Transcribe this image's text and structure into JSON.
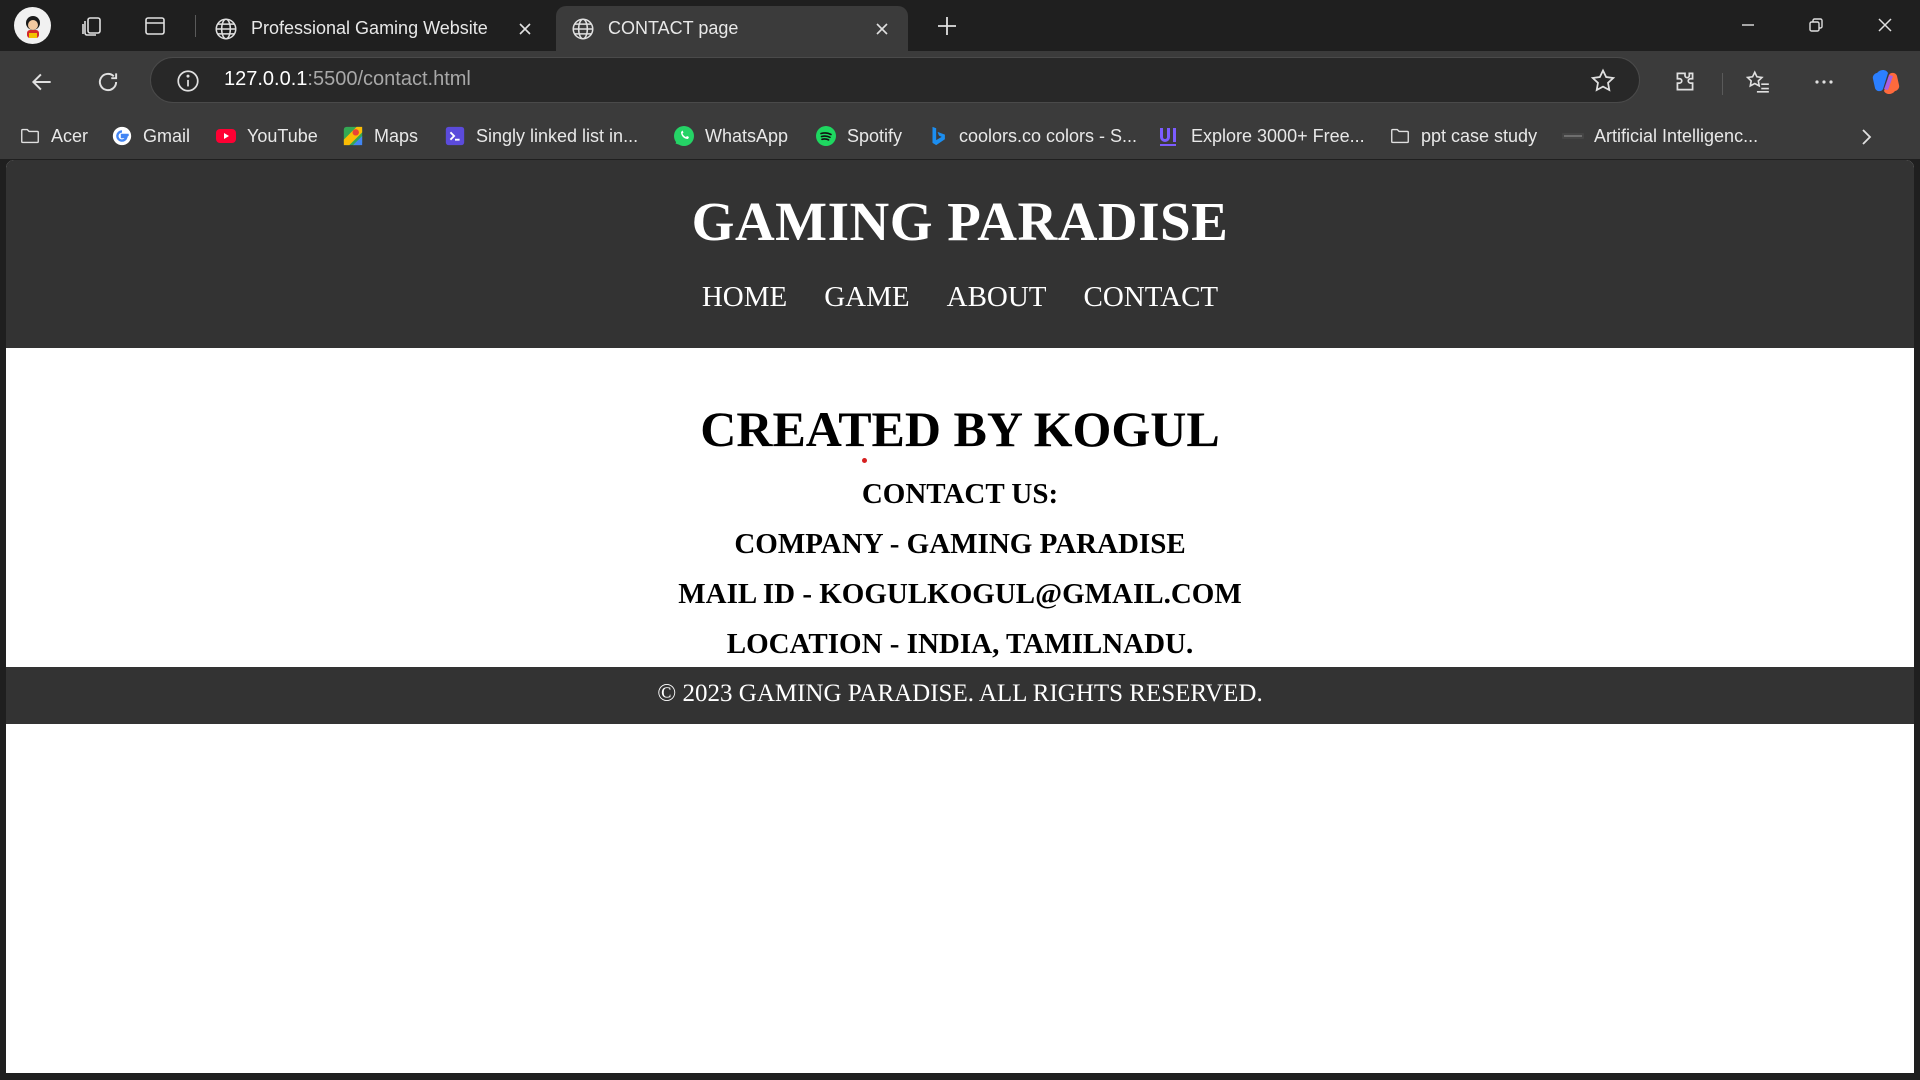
{
  "browser": {
    "tabs": [
      {
        "title": "Professional Gaming Website",
        "active": false
      },
      {
        "title": "CONTACT page",
        "active": true
      }
    ],
    "address": {
      "host": "127.0.0.1",
      "path": ":5500/contact.html"
    },
    "bookmarks": [
      {
        "label": "Acer",
        "icon": "folder-icon"
      },
      {
        "label": "Gmail",
        "icon": "google-icon"
      },
      {
        "label": "YouTube",
        "icon": "youtube-icon"
      },
      {
        "label": "Maps",
        "icon": "maps-icon"
      },
      {
        "label": "Singly linked list in...",
        "icon": "code-icon"
      },
      {
        "label": "WhatsApp",
        "icon": "whatsapp-icon"
      },
      {
        "label": "Spotify",
        "icon": "spotify-icon"
      },
      {
        "label": "coolors.co colors - S...",
        "icon": "bing-icon"
      },
      {
        "label": "Explore 3000+ Free...",
        "icon": "ui-icon"
      },
      {
        "label": "ppt case study",
        "icon": "folder-icon"
      },
      {
        "label": "Artificial Intelligenc...",
        "icon": "ai-icon"
      }
    ],
    "colors": {
      "chrome_dark": "#1f1f1f",
      "toolbar": "#3b3b3b",
      "site_dark": "#333333"
    }
  },
  "site": {
    "title": "GAMING PARADISE",
    "nav": [
      "HOME",
      "GAME",
      "ABOUT",
      "CONTACT"
    ],
    "created_by": "CREATED BY KOGUL",
    "contact_heading": "CONTACT US:",
    "company": "COMPANY - GAMING PARADISE",
    "mail": "MAIL ID - KOGULKOGUL@GMAIL.COM",
    "location": "LOCATION - INDIA, TAMILNADU.",
    "footer": "© 2023 GAMING PARADISE. ALL RIGHTS RESERVED."
  }
}
